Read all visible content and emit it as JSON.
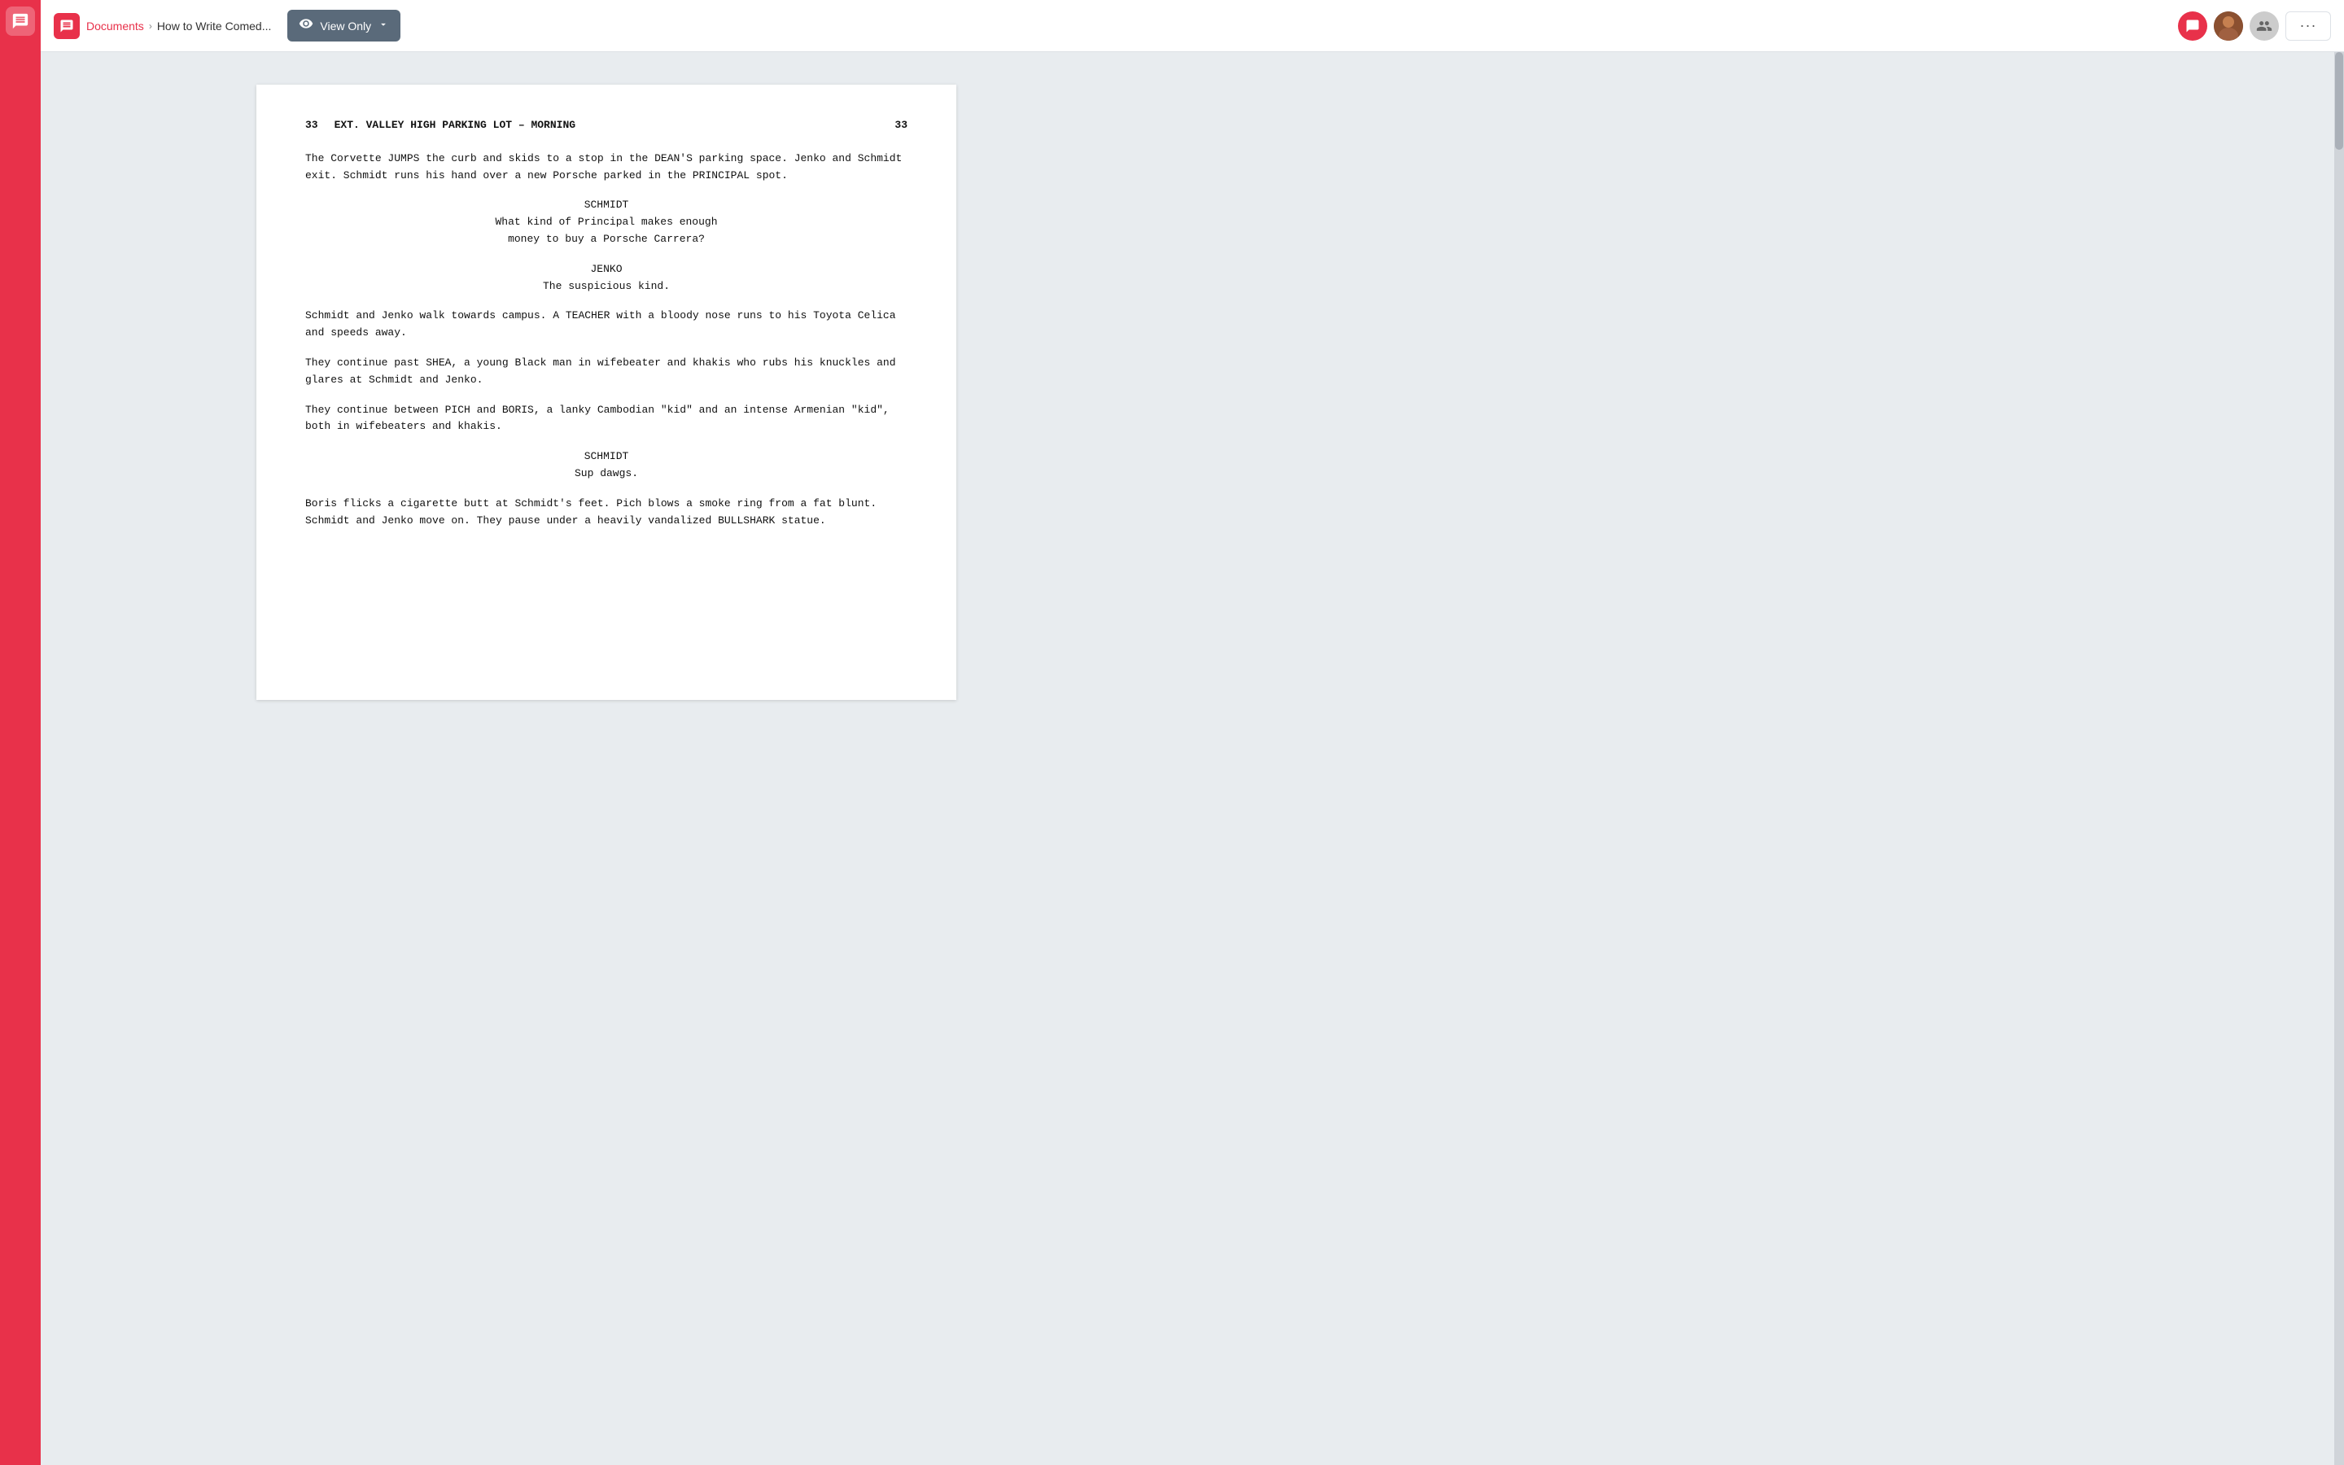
{
  "sidebar": {
    "app_icon": "💬"
  },
  "header": {
    "app_icon_label": "💬",
    "breadcrumb_documents": "Documents",
    "breadcrumb_separator": "›",
    "breadcrumb_current": "How to Write Comed...",
    "view_only_label": "View Only",
    "more_label": "···"
  },
  "script": {
    "scene_number_left": "33",
    "scene_number_right": "33",
    "scene_title": "EXT. VALLEY HIGH PARKING LOT – MORNING",
    "paragraphs": [
      "The Corvette JUMPS the curb and skids to a stop in the DEAN'S parking space. Jenko and Schmidt exit. Schmidt runs his hand over a new Porsche parked in the PRINCIPAL spot.",
      "Schmidt and Jenko walk towards campus. A TEACHER with a bloody nose runs to his Toyota Celica and speeds away.",
      "They continue past SHEA, a young Black man in wifebeater and khakis who rubs his knuckles and glares at Schmidt and Jenko.",
      "They continue between PICH and BORIS, a lanky Cambodian \"kid\" and an intense Armenian \"kid\", both in wifebeaters and khakis.",
      "Boris flicks a cigarette butt at Schmidt's feet. Pich blows a smoke ring from a fat blunt. Schmidt and Jenko move on. They pause under a heavily vandalized BULLSHARK statue."
    ],
    "dialogue": [
      {
        "character": "SCHMIDT",
        "lines": [
          "What kind of Principal makes enough",
          "money to buy a Porsche Carrera?"
        ]
      },
      {
        "character": "JENKO",
        "lines": [
          "The suspicious kind."
        ]
      },
      {
        "character": "SCHMIDT",
        "lines": [
          "Sup dawgs."
        ]
      }
    ]
  }
}
